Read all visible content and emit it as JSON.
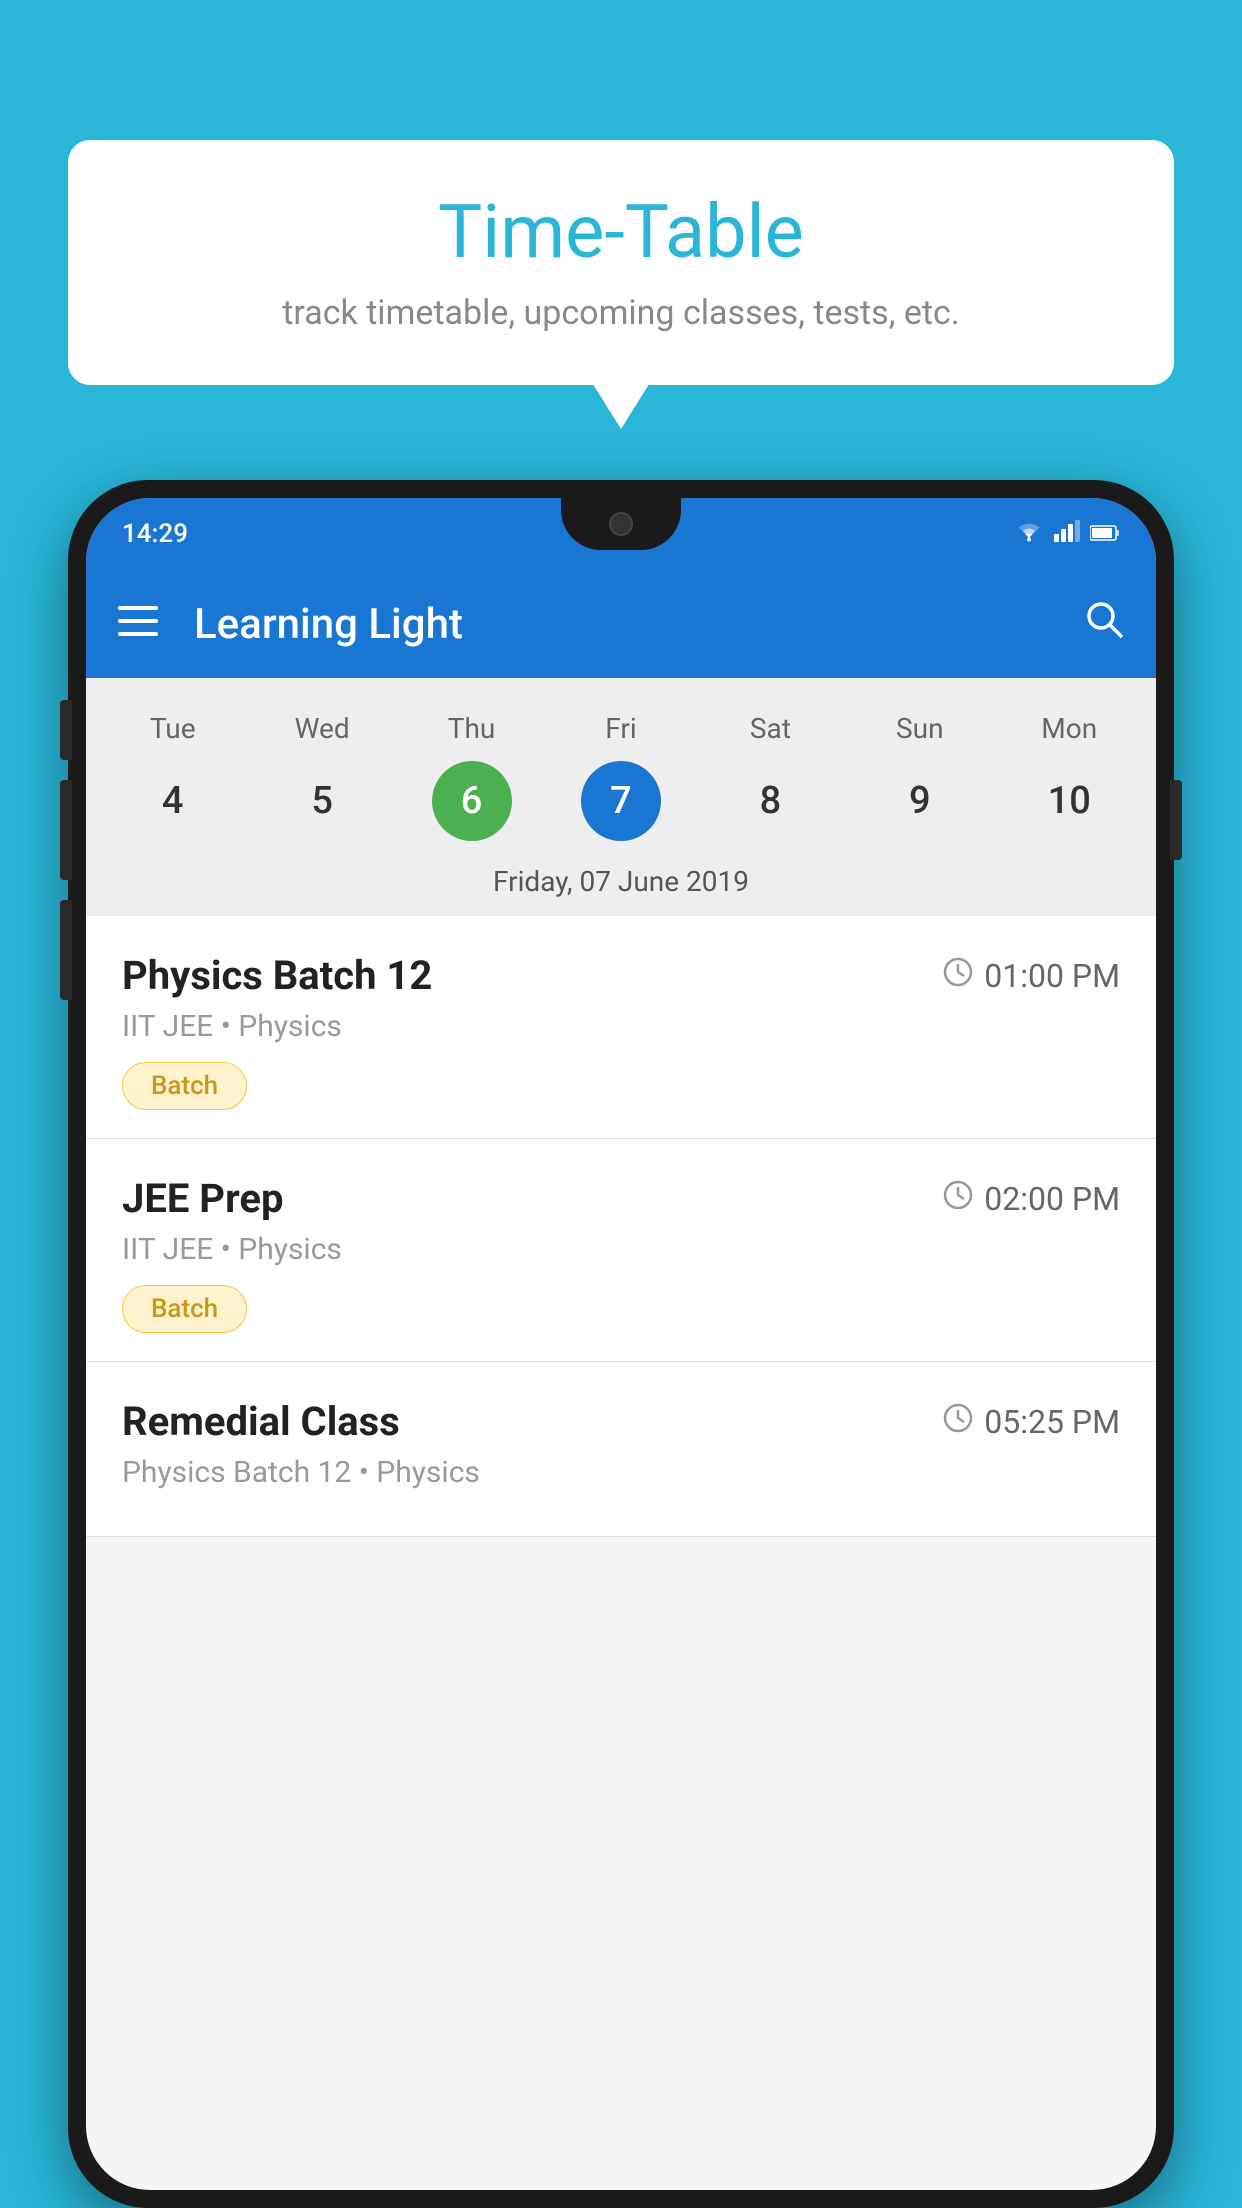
{
  "background_color": "#29B6D8",
  "speech_bubble": {
    "title": "Time-Table",
    "subtitle": "track timetable, upcoming classes, tests, etc."
  },
  "phone": {
    "status_bar": {
      "time": "14:29",
      "icons": [
        "wifi",
        "signal",
        "battery"
      ]
    },
    "app_bar": {
      "title": "Learning Light"
    },
    "calendar": {
      "days": [
        "Tue",
        "Wed",
        "Thu",
        "Fri",
        "Sat",
        "Sun",
        "Mon"
      ],
      "dates": [
        "4",
        "5",
        "6",
        "7",
        "8",
        "9",
        "10"
      ],
      "today_index": 2,
      "selected_index": 3,
      "selected_date_label": "Friday, 07 June 2019"
    },
    "schedule": [
      {
        "title": "Physics Batch 12",
        "time": "01:00 PM",
        "meta": "IIT JEE • Physics",
        "badge": "Batch"
      },
      {
        "title": "JEE Prep",
        "time": "02:00 PM",
        "meta": "IIT JEE • Physics",
        "badge": "Batch"
      },
      {
        "title": "Remedial Class",
        "time": "05:25 PM",
        "meta": "Physics Batch 12 • Physics",
        "badge": ""
      }
    ]
  }
}
